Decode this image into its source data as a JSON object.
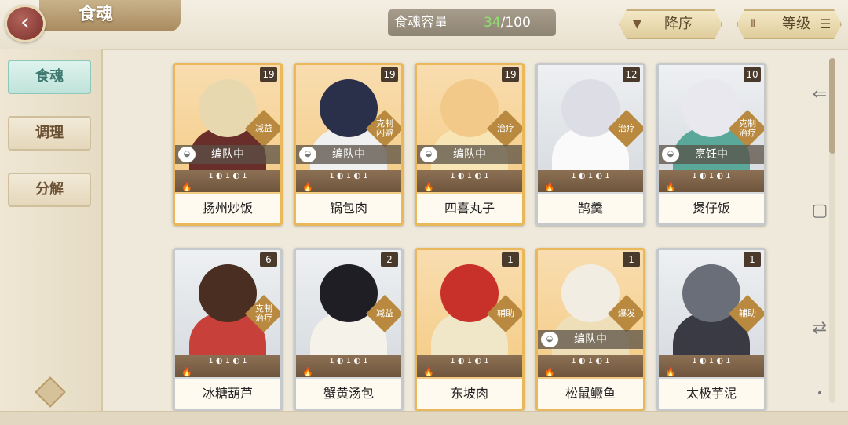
{
  "header": {
    "back_icon": "back-arrow-icon",
    "title": "食魂",
    "capacity_label": "食魂容量",
    "capacity_current": "34",
    "capacity_total": "/100",
    "sort_desc_label": "降序",
    "sort_level_label": "等级",
    "sort_desc_icon": "▼",
    "sort_level_icon": "⫴",
    "sort_level_menu": "☰"
  },
  "sidebar": {
    "items": [
      {
        "label": "食魂"
      },
      {
        "label": "调理"
      },
      {
        "label": "分解"
      }
    ]
  },
  "cards": [
    {
      "name": "扬州炒饭",
      "level": "19",
      "role": "减益",
      "status": "编队中",
      "bowls": "1 ◐ 1 ◐ 1",
      "rarity": "gold",
      "hair": "#e8d8b0",
      "outfit": "#6a2e2a"
    },
    {
      "name": "锅包肉",
      "level": "19",
      "role": "克制\n闪避",
      "status": "编队中",
      "bowls": "1 ◐ 1 ◐ 1",
      "rarity": "gold",
      "hair": "#2a2f4a",
      "outfit": "#f0f0f0"
    },
    {
      "name": "四喜丸子",
      "level": "19",
      "role": "治疗",
      "status": "编队中",
      "bowls": "1 ◐ 1 ◐ 1",
      "rarity": "gold",
      "hair": "#f2c988",
      "outfit": "#f7e5b5"
    },
    {
      "name": "鹄羹",
      "level": "12",
      "role": "治疗",
      "status": "",
      "bowls": "1 ◐ 1 ◐ 1",
      "rarity": "silver",
      "hair": "#dddde6",
      "outfit": "#fafafa"
    },
    {
      "name": "煲仔饭",
      "level": "10",
      "role": "克制\n治疗",
      "status": "烹饪中",
      "bowls": "1 ◐ 1 ◐ 1",
      "rarity": "silver",
      "hair": "#e8e8ee",
      "outfit": "#5aa89a"
    },
    {
      "name": "冰糖葫芦",
      "level": "6",
      "role": "克制\n治疗",
      "status": "",
      "bowls": "1 ◐ 1 ◐ 1",
      "rarity": "silver",
      "hair": "#4a2e22",
      "outfit": "#c8403a"
    },
    {
      "name": "蟹黄汤包",
      "level": "2",
      "role": "减益",
      "status": "",
      "bowls": "1 ◐ 1 ◐ 1",
      "rarity": "silver",
      "hair": "#1e1e24",
      "outfit": "#f5f2ea"
    },
    {
      "name": "东坡肉",
      "level": "1",
      "role": "辅助",
      "status": "",
      "bowls": "1 ◐ 1 ◐ 1",
      "rarity": "gold",
      "hair": "#c8302a",
      "outfit": "#f0e6c8"
    },
    {
      "name": "松鼠鳜鱼",
      "level": "1",
      "role": "爆发",
      "status": "编队中",
      "bowls": "1 ◐ 1 ◐ 1",
      "rarity": "gold",
      "hair": "#f2ede2",
      "outfit": "#eedfb8"
    },
    {
      "name": "太极芋泥",
      "level": "1",
      "role": "辅助",
      "status": "",
      "bowls": "1 ◐ 1 ◐ 1",
      "rarity": "silver",
      "hair": "#6a6e78",
      "outfit": "#3a3a44"
    }
  ],
  "rail": {
    "back_icon": "⇐",
    "square_icon": "▢",
    "switch_icon": "⇄",
    "dot_icon": "•"
  }
}
